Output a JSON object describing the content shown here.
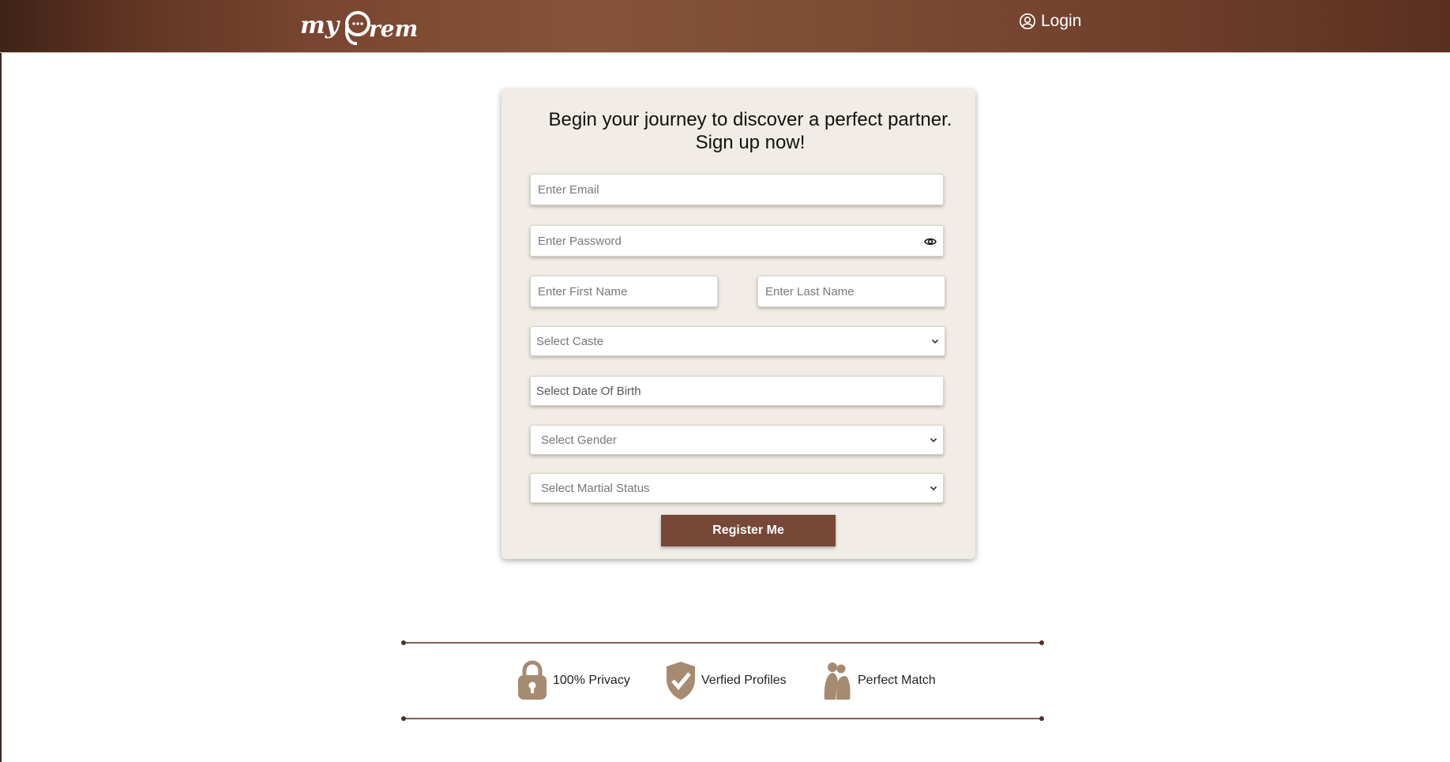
{
  "header": {
    "logo_text": "myPrem",
    "login_label": "Login"
  },
  "form": {
    "headline_line1": "Begin your journey to discover a perfect partner.",
    "headline_line2": "Sign up now!",
    "email_placeholder": "Enter Email",
    "password_placeholder": "Enter Password",
    "first_name_placeholder": "Enter First Name",
    "last_name_placeholder": "Enter Last Name",
    "caste_select": "Select Caste",
    "dob_field": "Select Date Of Birth",
    "gender_select": "Select Gender",
    "marital_select": "Select Martial Status",
    "register_label": "Register Me"
  },
  "features": [
    {
      "icon": "lock-icon",
      "label": "100% Privacy"
    },
    {
      "icon": "shield-check-icon",
      "label": "Verfied Profiles"
    },
    {
      "icon": "couple-icon",
      "label": "Perfect Match"
    }
  ],
  "colors": {
    "header_brown": "#7a4631",
    "button_brown": "#774737",
    "card_bg": "#f1ece5",
    "icon_tan": "#a68a72"
  }
}
